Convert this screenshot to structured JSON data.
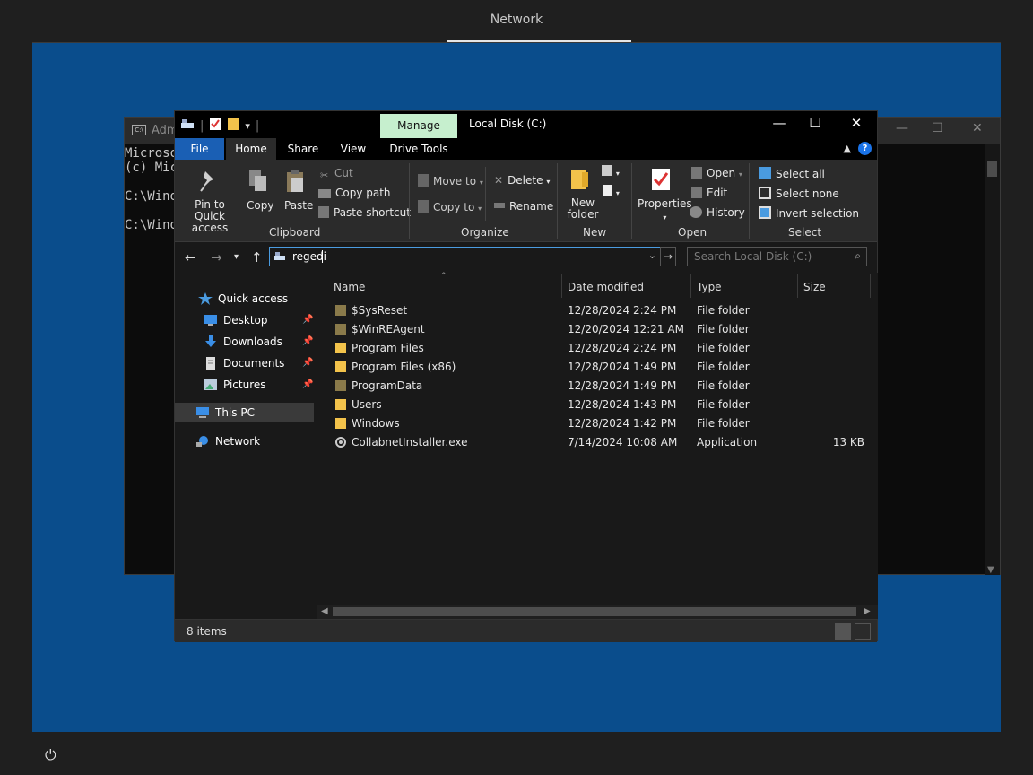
{
  "screen": {
    "title": "Network"
  },
  "cmd": {
    "title": "Adm",
    "lines": [
      "Microso",
      "(c) Mic",
      "",
      "C:\\Wind",
      "",
      "C:\\Wind"
    ]
  },
  "explorer": {
    "manage_tab": "Manage",
    "window_title": "Local Disk (C:)",
    "tabs": {
      "file": "File",
      "home": "Home",
      "share": "Share",
      "view": "View",
      "drive_tools": "Drive Tools"
    },
    "ribbon": {
      "clipboard": {
        "pin": "Pin to Quick access",
        "copy": "Copy",
        "paste": "Paste",
        "cut": "Cut",
        "copy_path": "Copy path",
        "paste_shortcut": "Paste shortcut",
        "label": "Clipboard"
      },
      "organize": {
        "move_to": "Move to",
        "copy_to": "Copy to",
        "delete": "Delete",
        "rename": "Rename",
        "label": "Organize"
      },
      "new": {
        "new_folder": "New folder",
        "label": "New"
      },
      "open": {
        "properties": "Properties",
        "open": "Open",
        "edit": "Edit",
        "history": "History",
        "label": "Open"
      },
      "select": {
        "select_all": "Select all",
        "select_none": "Select none",
        "invert": "Invert selection",
        "label": "Select"
      }
    },
    "address": {
      "value": "regedi"
    },
    "search": {
      "placeholder": "Search Local Disk (C:)"
    },
    "nav": {
      "quick_access": "Quick access",
      "desktop": "Desktop",
      "downloads": "Downloads",
      "documents": "Documents",
      "pictures": "Pictures",
      "this_pc": "This PC",
      "network": "Network"
    },
    "columns": {
      "name": "Name",
      "date": "Date modified",
      "type": "Type",
      "size": "Size"
    },
    "files": [
      {
        "name": "$SysReset",
        "date": "12/28/2024 2:24 PM",
        "type": "File folder",
        "size": "",
        "icon": "hidden-folder-icon"
      },
      {
        "name": "$WinREAgent",
        "date": "12/20/2024 12:21 AM",
        "type": "File folder",
        "size": "",
        "icon": "hidden-folder-icon"
      },
      {
        "name": "Program Files",
        "date": "12/28/2024 2:24 PM",
        "type": "File folder",
        "size": "",
        "icon": "folder-icon"
      },
      {
        "name": "Program Files (x86)",
        "date": "12/28/2024 1:49 PM",
        "type": "File folder",
        "size": "",
        "icon": "folder-icon"
      },
      {
        "name": "ProgramData",
        "date": "12/28/2024 1:49 PM",
        "type": "File folder",
        "size": "",
        "icon": "hidden-folder-icon"
      },
      {
        "name": "Users",
        "date": "12/28/2024 1:43 PM",
        "type": "File folder",
        "size": "",
        "icon": "folder-icon"
      },
      {
        "name": "Windows",
        "date": "12/28/2024 1:42 PM",
        "type": "File folder",
        "size": "",
        "icon": "folder-icon"
      },
      {
        "name": "CollabnetInstaller.exe",
        "date": "7/14/2024 10:08 AM",
        "type": "Application",
        "size": "13 KB",
        "icon": "exe-icon"
      }
    ],
    "status": {
      "count": "8 items"
    }
  }
}
